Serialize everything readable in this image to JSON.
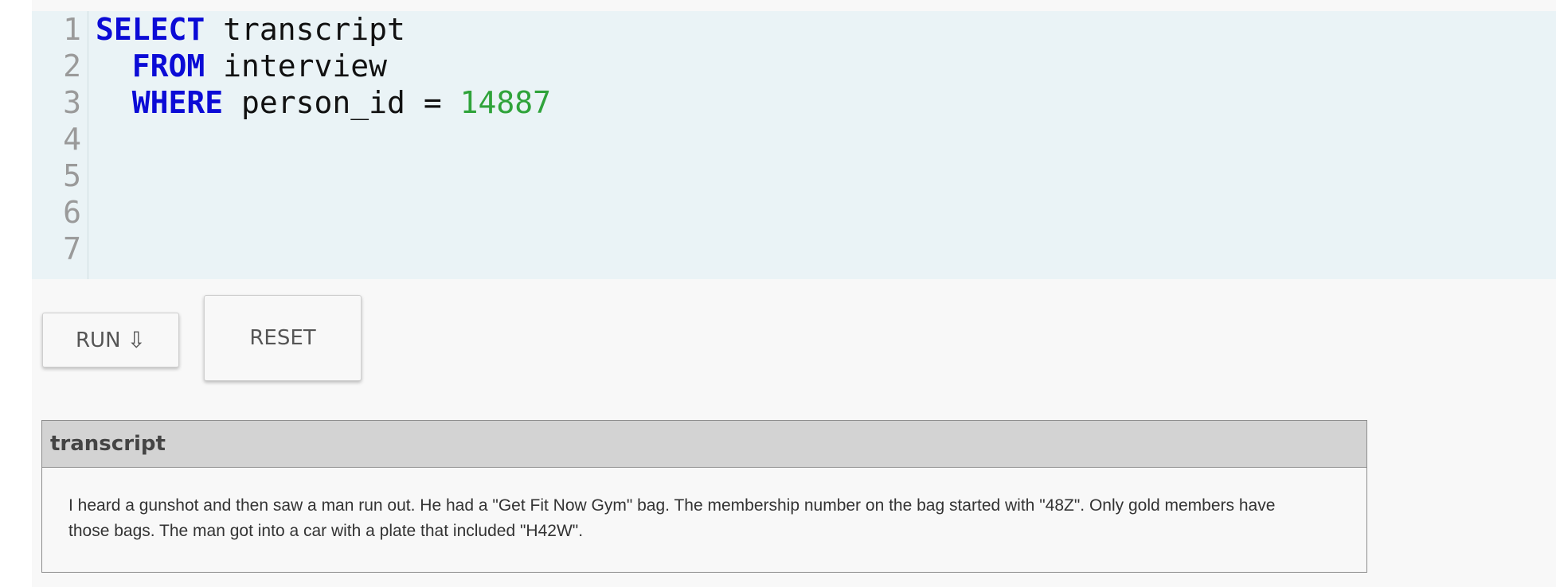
{
  "editor": {
    "line_numbers": [
      "1",
      "2",
      "3",
      "4",
      "5",
      "6",
      "7"
    ],
    "lines": [
      {
        "kw": "SELECT",
        "rest": " transcript",
        "num": "",
        "indent": ""
      },
      {
        "kw": "FROM",
        "rest": " interview",
        "num": "",
        "indent": "  "
      },
      {
        "kw": "WHERE",
        "rest": " person_id = ",
        "num": "14887",
        "indent": "  "
      }
    ]
  },
  "buttons": {
    "run_label": "RUN",
    "run_icon": "⇩",
    "reset_label": "RESET"
  },
  "results": {
    "columns": [
      "transcript"
    ],
    "rows": [
      [
        "I heard a gunshot and then saw a man run out. He had a \"Get Fit Now Gym\" bag. The membership number on the bag started with \"48Z\". Only gold members have those bags. The man got into a car with a plate that included \"H42W\"."
      ]
    ]
  },
  "colors": {
    "editor_bg": "#eaf3f6",
    "keyword": "#0b0bd6",
    "number": "#2fa33a",
    "table_header_bg": "#d3d3d3"
  }
}
